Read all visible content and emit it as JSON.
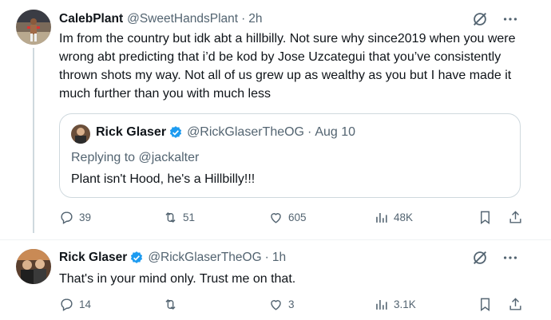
{
  "tweet1": {
    "name": "CalebPlant",
    "handle": "@SweetHandsPlant",
    "dot": "·",
    "time": "2h",
    "text": "Im from the country but idk abt a hillbilly. Not sure why since2019 when you were wrong abt predicting that i’d be kod by Jose Uzcategui that you’ve consistently thrown shots my way. Not all of us grew up as wealthy as you but I have made it much further than you with much less",
    "quote": {
      "name": "Rick Glaser",
      "handle": "@RickGlaserTheOG",
      "dot": "·",
      "time": "Aug 10",
      "replying_prefix": "Replying to ",
      "replying_to": "@jackalter",
      "text": "Plant isn't Hood, he's a Hillbilly!!!"
    },
    "actions": {
      "replies": "39",
      "reposts": "51",
      "likes": "605",
      "views": "48K"
    }
  },
  "tweet2": {
    "name": "Rick Glaser",
    "handle": "@RickGlaserTheOG",
    "dot": "·",
    "time": "1h",
    "text": "That's in your mind only. Trust me on that.",
    "actions": {
      "replies": "14",
      "reposts": "",
      "likes": "3",
      "views": "3.1K"
    }
  },
  "colors": {
    "verified_blue": "#1d9bf0",
    "secondary_text": "#536471",
    "border": "#cfd9de"
  },
  "icons": [
    "grok-icon",
    "more-icon",
    "reply-icon",
    "repost-icon",
    "like-icon",
    "views-icon",
    "bookmark-icon",
    "share-icon",
    "verified-icon"
  ]
}
